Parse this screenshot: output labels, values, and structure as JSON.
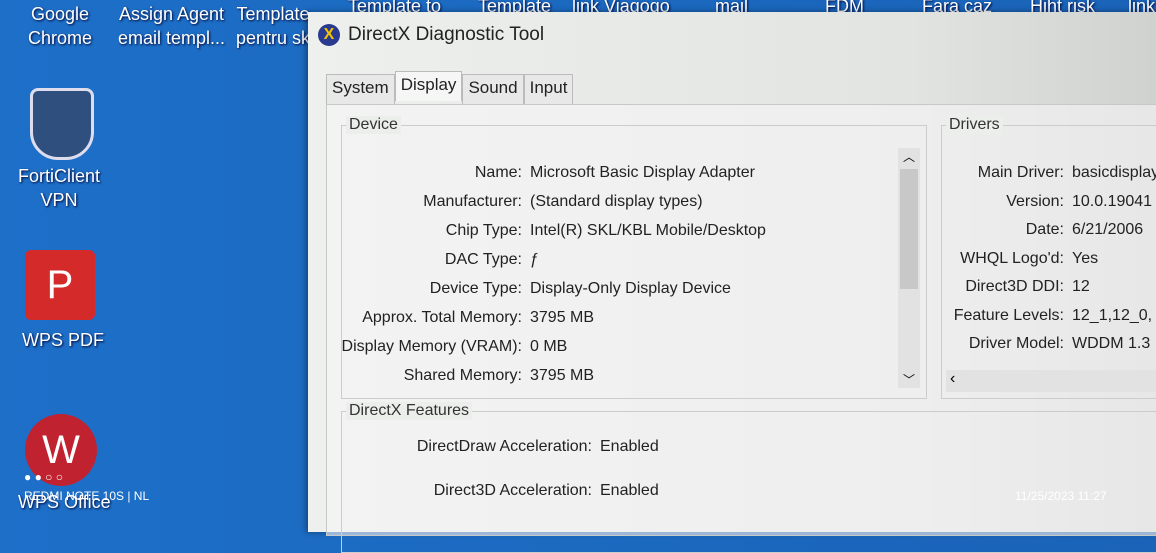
{
  "desktop": {
    "top_icons": [
      "Google\nChrome",
      "Assign Agent\nemail templ...",
      "Template\npentru sk",
      "Template to",
      "Template",
      "link Viagogo",
      "mail",
      "FDM",
      "Fara caz",
      "Hiht risk",
      "link"
    ],
    "side_icons": [
      {
        "label": "FortiClient\nVPN",
        "icon": "forticlient-icon"
      },
      {
        "label": "WPS PDF",
        "icon": "wps-pdf-icon"
      },
      {
        "label": "WPS Office",
        "icon": "wps-office-icon"
      }
    ]
  },
  "window": {
    "title": "DirectX Diagnostic Tool",
    "tabs": [
      "System",
      "Display",
      "Sound",
      "Input"
    ],
    "active_tab": "Display",
    "device": {
      "label": "Device",
      "rows": [
        {
          "k": "Name:",
          "v": "Microsoft Basic Display Adapter"
        },
        {
          "k": "Manufacturer:",
          "v": "(Standard display types)"
        },
        {
          "k": "Chip Type:",
          "v": "Intel(R) SKL/KBL Mobile/Desktop"
        },
        {
          "k": "DAC Type:",
          "v": "ƒ"
        },
        {
          "k": "Device Type:",
          "v": "Display-Only Display Device"
        },
        {
          "k": "Approx. Total Memory:",
          "v": "3795 MB"
        },
        {
          "k": "Display Memory (VRAM):",
          "v": "0 MB"
        },
        {
          "k": "Shared Memory:",
          "v": "3795 MB"
        }
      ]
    },
    "drivers": {
      "label": "Drivers",
      "rows": [
        {
          "k": "Main Driver:",
          "v": "basicdisplay"
        },
        {
          "k": "Version:",
          "v": "10.0.19041"
        },
        {
          "k": "Date:",
          "v": "6/21/2006"
        },
        {
          "k": "WHQL Logo'd:",
          "v": "Yes"
        },
        {
          "k": "Direct3D DDI:",
          "v": "12"
        },
        {
          "k": "Feature Levels:",
          "v": "12_1,12_0,"
        },
        {
          "k": "Driver Model:",
          "v": "WDDM 1.3"
        }
      ]
    },
    "features": {
      "label": "DirectX Features",
      "rows": [
        {
          "k": "DirectDraw Acceleration:",
          "v": "Enabled"
        },
        {
          "k": "Direct3D Acceleration:",
          "v": "Enabled"
        }
      ]
    }
  },
  "photo": {
    "device": "REDMI NOTE 10S | NL",
    "timestamp": "11/25/2023 11:27"
  }
}
